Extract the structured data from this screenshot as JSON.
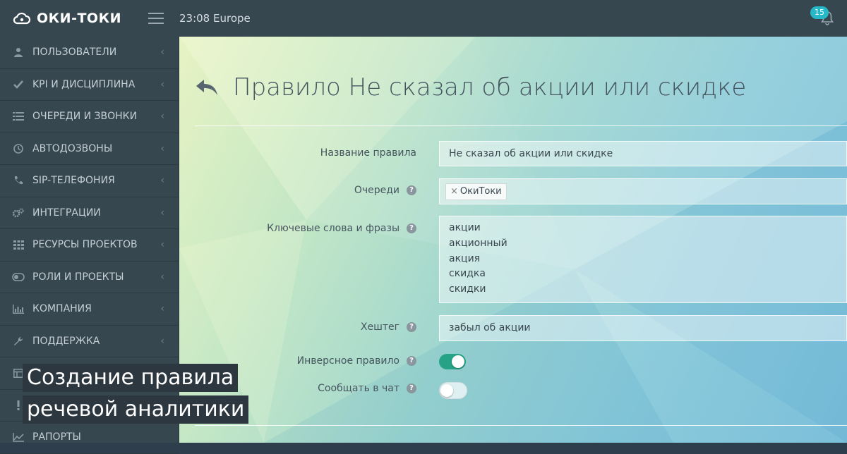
{
  "topbar": {
    "logo_text": "ОКИ-ТОКИ",
    "time": "23:08",
    "timezone": "Europe",
    "notifications_count": "15"
  },
  "sidebar": {
    "items": [
      {
        "label": "ПОЛЬЗОВАТЕЛИ",
        "icon": "user-icon"
      },
      {
        "label": "KPI И ДИСЦИПЛИНА",
        "icon": "check-icon"
      },
      {
        "label": "ОЧЕРЕДИ И ЗВОНКИ",
        "icon": "list-icon"
      },
      {
        "label": "АВТОДОЗВОНЫ",
        "icon": "clock-icon"
      },
      {
        "label": "SIP-ТЕЛЕФОНИЯ",
        "icon": "phone-icon"
      },
      {
        "label": "ИНТЕГРАЦИИ",
        "icon": "gears-icon"
      },
      {
        "label": "РЕСУРСЫ ПРОЕКТОВ",
        "icon": "grid-icon"
      },
      {
        "label": "РОЛИ И ПРОЕКТЫ",
        "icon": "toggle-icon"
      },
      {
        "label": "КОМПАНИЯ",
        "icon": "bar-chart-icon"
      },
      {
        "label": "ПОДДЕРЖКА",
        "icon": "wrench-icon"
      },
      {
        "label": "",
        "icon": "table-icon"
      },
      {
        "label": "",
        "icon": "exclamation-icon"
      },
      {
        "label": "РАПОРТЫ",
        "icon": "line-chart-icon"
      }
    ]
  },
  "page": {
    "title": "Правило Не сказал об акции или скидке"
  },
  "form": {
    "rule_name_label": "Название правила",
    "rule_name_value": "Не сказал об акции или скидке",
    "queues_label": "Очереди",
    "queue_tag": "ОкиТоки",
    "keywords_label": "Ключевые слова и фразы",
    "keywords": [
      "акции",
      "акционный",
      "акция",
      "скидка",
      "скидки"
    ],
    "hashtag_label": "Хештег",
    "hashtag_value": "забыл об акции",
    "inverse_label": "Инверсное правило",
    "inverse_on": true,
    "notify_label": "Сообщать в чат",
    "notify_on": false
  },
  "caption": {
    "line1": "Создание правила",
    "line2": "речевой аналитики"
  },
  "colors": {
    "toggle_on": "#26a386",
    "sidebar_bg": "#37474f"
  }
}
